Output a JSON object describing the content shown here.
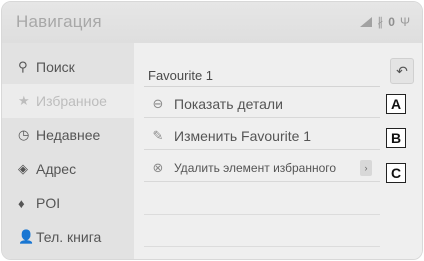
{
  "app": {
    "title": "Навигация"
  },
  "status": {
    "bluetooth": "∦",
    "bt_count": "0",
    "extra": "Ψ"
  },
  "sidebar": {
    "items": [
      {
        "label": "Поиск",
        "icon": "search-icon",
        "glyph": "⚲"
      },
      {
        "label": "Избранное",
        "icon": "star-icon",
        "glyph": "★"
      },
      {
        "label": "Недавнее",
        "icon": "clock-icon",
        "glyph": "◷"
      },
      {
        "label": "Адрес",
        "icon": "address-icon",
        "glyph": "◈"
      },
      {
        "label": "POI",
        "icon": "pin-icon",
        "glyph": "♦"
      },
      {
        "label": "Тел. книга",
        "icon": "contact-icon",
        "glyph": "👤"
      }
    ]
  },
  "main": {
    "header_title": "Favourite 1",
    "back_glyph": "↶",
    "options": [
      {
        "label": "Показать детали",
        "glyph": "⊖",
        "icon": "details-icon"
      },
      {
        "label": "Изменить Favourite 1",
        "glyph": "✎",
        "icon": "pencil-icon"
      },
      {
        "label": "Удалить элемент избранного",
        "glyph": "⊗",
        "icon": "delete-icon"
      }
    ],
    "more_glyph": "›"
  },
  "callouts": [
    "A",
    "B",
    "C"
  ]
}
